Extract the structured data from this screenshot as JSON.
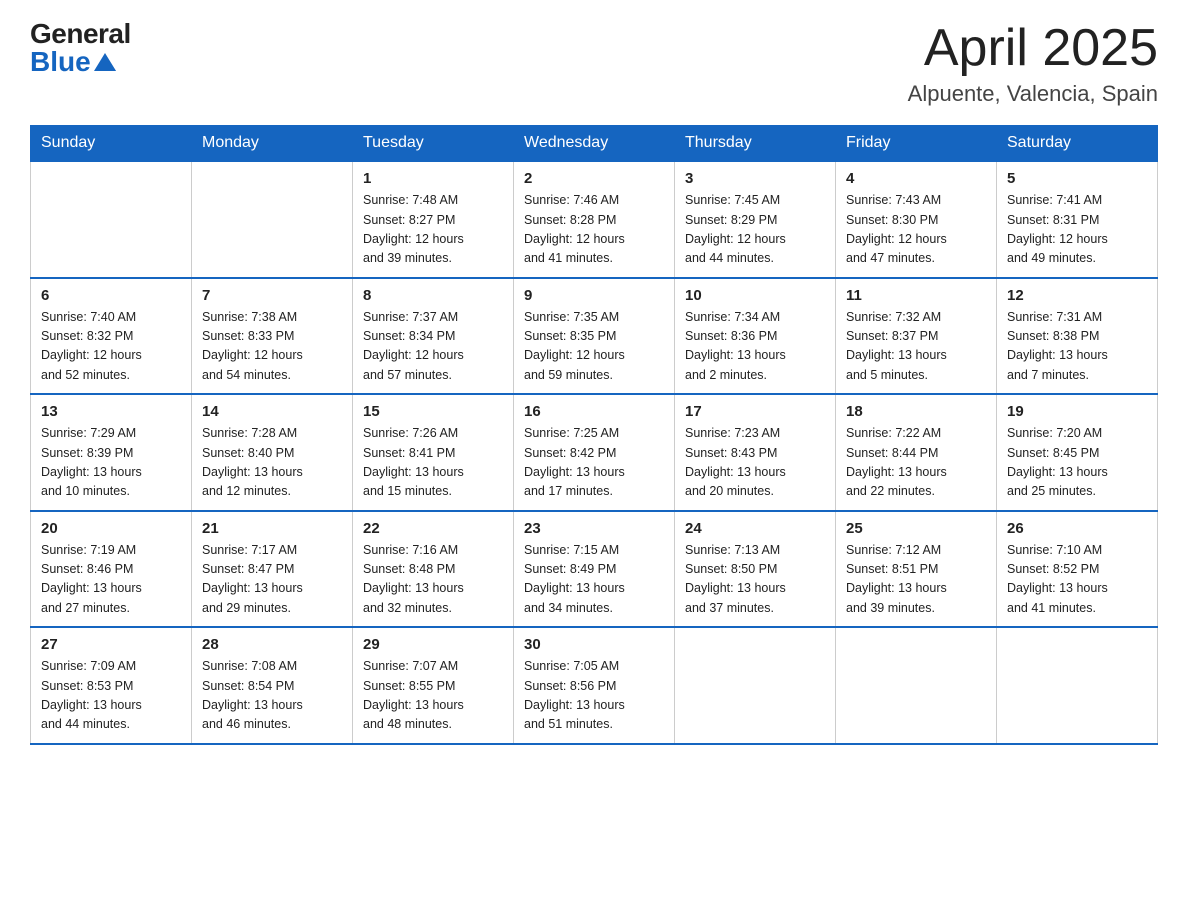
{
  "logo": {
    "general": "General",
    "blue": "Blue"
  },
  "title": {
    "month_year": "April 2025",
    "location": "Alpuente, Valencia, Spain"
  },
  "weekdays": [
    "Sunday",
    "Monday",
    "Tuesday",
    "Wednesday",
    "Thursday",
    "Friday",
    "Saturday"
  ],
  "weeks": [
    [
      {
        "day": "",
        "info": ""
      },
      {
        "day": "",
        "info": ""
      },
      {
        "day": "1",
        "info": "Sunrise: 7:48 AM\nSunset: 8:27 PM\nDaylight: 12 hours\nand 39 minutes."
      },
      {
        "day": "2",
        "info": "Sunrise: 7:46 AM\nSunset: 8:28 PM\nDaylight: 12 hours\nand 41 minutes."
      },
      {
        "day": "3",
        "info": "Sunrise: 7:45 AM\nSunset: 8:29 PM\nDaylight: 12 hours\nand 44 minutes."
      },
      {
        "day": "4",
        "info": "Sunrise: 7:43 AM\nSunset: 8:30 PM\nDaylight: 12 hours\nand 47 minutes."
      },
      {
        "day": "5",
        "info": "Sunrise: 7:41 AM\nSunset: 8:31 PM\nDaylight: 12 hours\nand 49 minutes."
      }
    ],
    [
      {
        "day": "6",
        "info": "Sunrise: 7:40 AM\nSunset: 8:32 PM\nDaylight: 12 hours\nand 52 minutes."
      },
      {
        "day": "7",
        "info": "Sunrise: 7:38 AM\nSunset: 8:33 PM\nDaylight: 12 hours\nand 54 minutes."
      },
      {
        "day": "8",
        "info": "Sunrise: 7:37 AM\nSunset: 8:34 PM\nDaylight: 12 hours\nand 57 minutes."
      },
      {
        "day": "9",
        "info": "Sunrise: 7:35 AM\nSunset: 8:35 PM\nDaylight: 12 hours\nand 59 minutes."
      },
      {
        "day": "10",
        "info": "Sunrise: 7:34 AM\nSunset: 8:36 PM\nDaylight: 13 hours\nand 2 minutes."
      },
      {
        "day": "11",
        "info": "Sunrise: 7:32 AM\nSunset: 8:37 PM\nDaylight: 13 hours\nand 5 minutes."
      },
      {
        "day": "12",
        "info": "Sunrise: 7:31 AM\nSunset: 8:38 PM\nDaylight: 13 hours\nand 7 minutes."
      }
    ],
    [
      {
        "day": "13",
        "info": "Sunrise: 7:29 AM\nSunset: 8:39 PM\nDaylight: 13 hours\nand 10 minutes."
      },
      {
        "day": "14",
        "info": "Sunrise: 7:28 AM\nSunset: 8:40 PM\nDaylight: 13 hours\nand 12 minutes."
      },
      {
        "day": "15",
        "info": "Sunrise: 7:26 AM\nSunset: 8:41 PM\nDaylight: 13 hours\nand 15 minutes."
      },
      {
        "day": "16",
        "info": "Sunrise: 7:25 AM\nSunset: 8:42 PM\nDaylight: 13 hours\nand 17 minutes."
      },
      {
        "day": "17",
        "info": "Sunrise: 7:23 AM\nSunset: 8:43 PM\nDaylight: 13 hours\nand 20 minutes."
      },
      {
        "day": "18",
        "info": "Sunrise: 7:22 AM\nSunset: 8:44 PM\nDaylight: 13 hours\nand 22 minutes."
      },
      {
        "day": "19",
        "info": "Sunrise: 7:20 AM\nSunset: 8:45 PM\nDaylight: 13 hours\nand 25 minutes."
      }
    ],
    [
      {
        "day": "20",
        "info": "Sunrise: 7:19 AM\nSunset: 8:46 PM\nDaylight: 13 hours\nand 27 minutes."
      },
      {
        "day": "21",
        "info": "Sunrise: 7:17 AM\nSunset: 8:47 PM\nDaylight: 13 hours\nand 29 minutes."
      },
      {
        "day": "22",
        "info": "Sunrise: 7:16 AM\nSunset: 8:48 PM\nDaylight: 13 hours\nand 32 minutes."
      },
      {
        "day": "23",
        "info": "Sunrise: 7:15 AM\nSunset: 8:49 PM\nDaylight: 13 hours\nand 34 minutes."
      },
      {
        "day": "24",
        "info": "Sunrise: 7:13 AM\nSunset: 8:50 PM\nDaylight: 13 hours\nand 37 minutes."
      },
      {
        "day": "25",
        "info": "Sunrise: 7:12 AM\nSunset: 8:51 PM\nDaylight: 13 hours\nand 39 minutes."
      },
      {
        "day": "26",
        "info": "Sunrise: 7:10 AM\nSunset: 8:52 PM\nDaylight: 13 hours\nand 41 minutes."
      }
    ],
    [
      {
        "day": "27",
        "info": "Sunrise: 7:09 AM\nSunset: 8:53 PM\nDaylight: 13 hours\nand 44 minutes."
      },
      {
        "day": "28",
        "info": "Sunrise: 7:08 AM\nSunset: 8:54 PM\nDaylight: 13 hours\nand 46 minutes."
      },
      {
        "day": "29",
        "info": "Sunrise: 7:07 AM\nSunset: 8:55 PM\nDaylight: 13 hours\nand 48 minutes."
      },
      {
        "day": "30",
        "info": "Sunrise: 7:05 AM\nSunset: 8:56 PM\nDaylight: 13 hours\nand 51 minutes."
      },
      {
        "day": "",
        "info": ""
      },
      {
        "day": "",
        "info": ""
      },
      {
        "day": "",
        "info": ""
      }
    ]
  ]
}
